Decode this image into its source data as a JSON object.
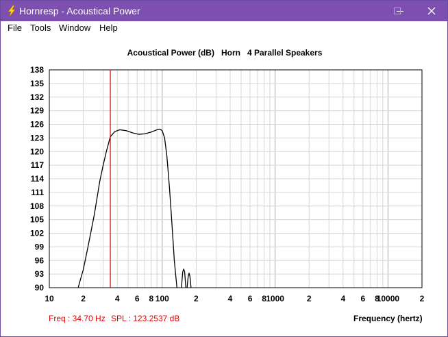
{
  "window": {
    "title": "Hornresp - Acoustical Power",
    "icon": "lightning-bolt-icon",
    "controls": [
      "minimize-icon",
      "maximize-icon",
      "close-icon"
    ],
    "title_color": "#7c4fb0"
  },
  "menu": {
    "items": [
      {
        "label": "File"
      },
      {
        "label": "Tools"
      },
      {
        "label": "Window"
      },
      {
        "label": "Help"
      }
    ]
  },
  "chart_data": {
    "type": "line",
    "title": "Acoustical Power (dB)   Horn   4 Parallel Speakers",
    "xlabel": "Frequency (hertz)",
    "ylabel": "",
    "xscale": "log",
    "xlim": [
      10,
      20000
    ],
    "ylim": [
      90,
      138
    ],
    "yticks": [
      90,
      93,
      96,
      99,
      102,
      105,
      108,
      111,
      114,
      117,
      120,
      123,
      126,
      129,
      132,
      135,
      138
    ],
    "xtick_labels": [
      {
        "value": 10,
        "label": "10"
      },
      {
        "value": 20,
        "label": "2"
      },
      {
        "value": 40,
        "label": "4"
      },
      {
        "value": 60,
        "label": "6"
      },
      {
        "value": 80,
        "label": "8"
      },
      {
        "value": 100,
        "label": "100"
      },
      {
        "value": 200,
        "label": "2"
      },
      {
        "value": 400,
        "label": "4"
      },
      {
        "value": 600,
        "label": "6"
      },
      {
        "value": 800,
        "label": "8"
      },
      {
        "value": 1000,
        "label": "1000"
      },
      {
        "value": 2000,
        "label": "2"
      },
      {
        "value": 4000,
        "label": "4"
      },
      {
        "value": 6000,
        "label": "6"
      },
      {
        "value": 8000,
        "label": "8"
      },
      {
        "value": 10000,
        "label": "10000"
      },
      {
        "value": 20000,
        "label": "2"
      }
    ],
    "grid": true,
    "series": [
      {
        "color": "#000000",
        "points": [
          [
            18,
            90
          ],
          [
            20,
            94
          ],
          [
            22,
            99
          ],
          [
            25,
            106
          ],
          [
            28,
            113.5
          ],
          [
            30,
            117
          ],
          [
            32,
            120
          ],
          [
            34.7,
            123.25
          ],
          [
            38,
            124.4
          ],
          [
            42,
            124.8
          ],
          [
            48,
            124.6
          ],
          [
            55,
            124.1
          ],
          [
            62,
            123.8
          ],
          [
            70,
            123.9
          ],
          [
            80,
            124.3
          ],
          [
            90,
            124.8
          ],
          [
            96,
            124.9
          ],
          [
            100,
            124.6
          ],
          [
            105,
            123
          ],
          [
            110,
            119
          ],
          [
            116,
            112
          ],
          [
            122,
            104
          ],
          [
            128,
            96
          ],
          [
            135,
            90
          ]
        ]
      },
      {
        "color": "#000000",
        "points": [
          [
            148,
            90
          ],
          [
            152,
            93.5
          ],
          [
            155,
            94.1
          ],
          [
            158,
            93.5
          ],
          [
            162,
            90
          ]
        ]
      },
      {
        "color": "#000000",
        "points": [
          [
            166,
            90
          ],
          [
            170,
            92.5
          ],
          [
            173,
            93.2
          ],
          [
            176,
            92.5
          ],
          [
            180,
            90
          ]
        ]
      }
    ],
    "marker": {
      "x": 34.7,
      "color": "#e00000"
    }
  },
  "readout": {
    "freq": "Freq : 34.70 Hz",
    "spl": "SPL : 123.2537 dB",
    "color": "#e00000"
  }
}
